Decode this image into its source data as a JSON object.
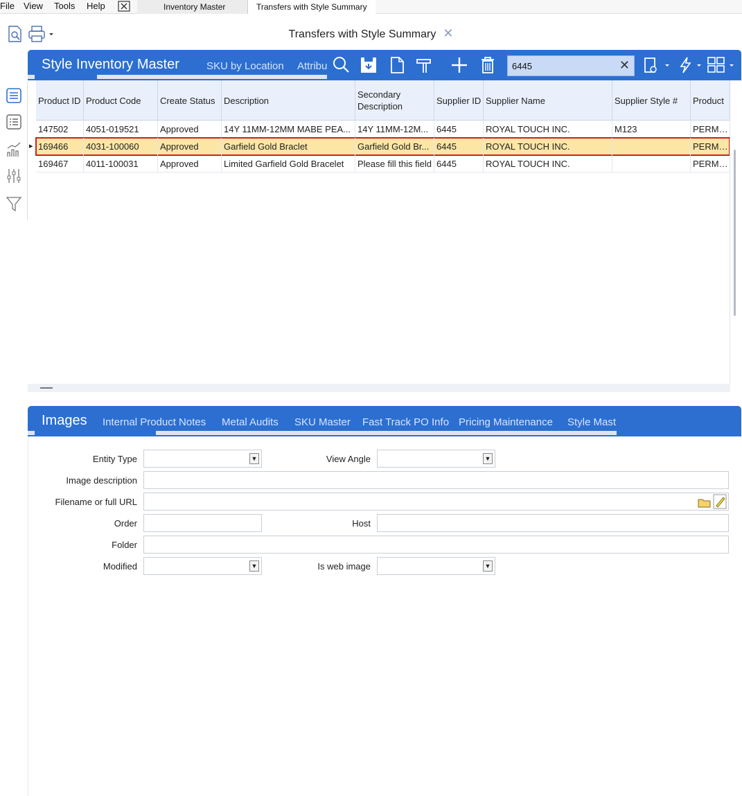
{
  "menu": [
    "File",
    "View",
    "Tools",
    "Help"
  ],
  "doc_tabs": [
    "Inventory Master",
    "Transfers with Style Summary"
  ],
  "document": {
    "title": "Transfers with Style Summary"
  },
  "top_panel": {
    "title": "Style Inventory Master",
    "tabs": [
      "SKU by Location",
      "Attribu"
    ],
    "search_value": "6445"
  },
  "grid": {
    "columns": [
      "Product ID",
      "Product Code",
      "Create Status",
      "Description",
      "Secondary Description",
      "Supplier ID",
      "Supplier Name",
      "Supplier Style #",
      "Product"
    ],
    "rows": [
      [
        "147502",
        "4051-019521",
        "Approved",
        "14Y 11MM-12MM MABE PEA...",
        "14Y 11MM-12M...",
        "6445",
        "ROYAL TOUCH INC.",
        "M123",
        "PERMAN"
      ],
      [
        "169466",
        "4031-100060",
        "Approved",
        "Garfield Gold Braclet",
        "Garfield Gold Br...",
        "6445",
        "ROYAL TOUCH INC.",
        "",
        "PERMAN"
      ],
      [
        "169467",
        "4011-100031",
        "Approved",
        "Limited Garfield Gold Bracelet",
        "Please fill this field",
        "6445",
        "ROYAL TOUCH INC.",
        "",
        "PERMAN"
      ]
    ],
    "selected_row": 1
  },
  "bottom_panel": {
    "title": "Images",
    "tabs": [
      "Internal Product Notes",
      "Metal Audits",
      "SKU Master",
      "Fast Track PO Info",
      "Pricing Maintenance",
      "Style Mast"
    ]
  },
  "form": {
    "entity_type": "Entity Type",
    "view_angle": "View Angle",
    "image_description": "Image description",
    "filename": "Filename or full URL",
    "order": "Order",
    "host": "Host",
    "folder": "Folder",
    "modified": "Modified",
    "is_web_image": "Is web image"
  },
  "colors": {
    "accent": "#2c6fd1",
    "selected_row": "#fbe6a6",
    "highlight_border": "#d11e1e"
  }
}
